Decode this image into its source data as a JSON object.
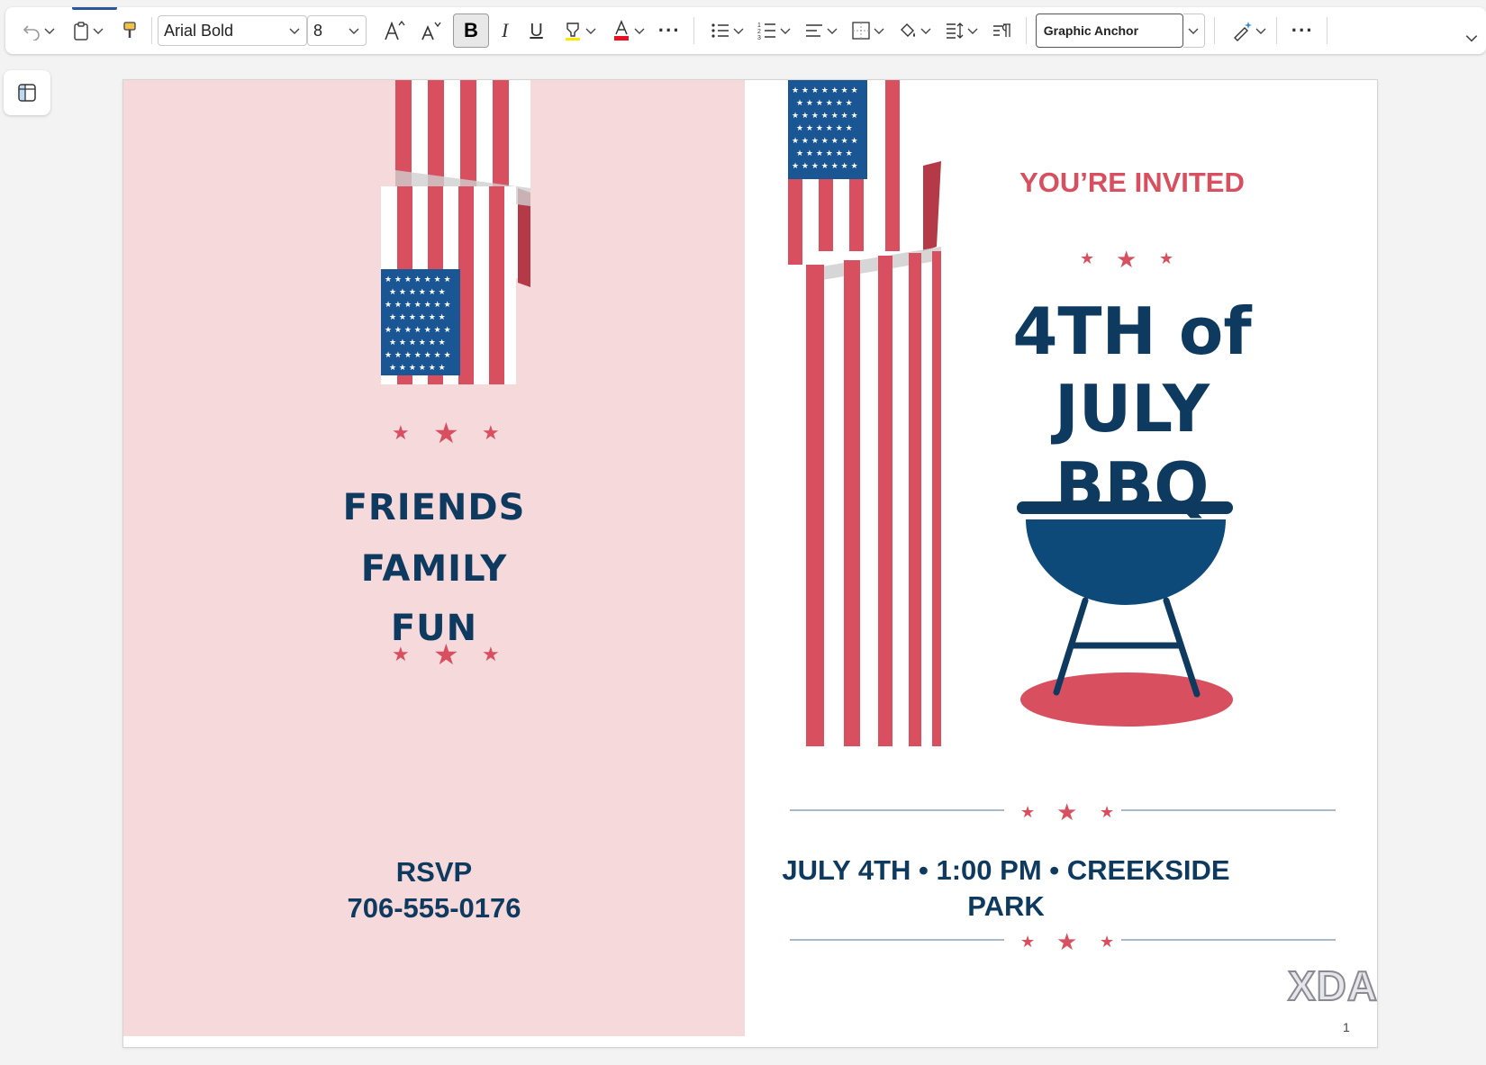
{
  "toolbar": {
    "font_name": "Arial Bold",
    "font_size": "8",
    "bold_label": "B",
    "italic_label": "I",
    "underline_label": "U",
    "style_name": "Graphic Anchor",
    "more_label": "···"
  },
  "colors": {
    "navy": "#0e3a5f",
    "red": "#d8505f",
    "pink_panel": "#f6d9db",
    "flag_blue": "#1a5694",
    "font_color_bar": "#e81123"
  },
  "document": {
    "left_panel": {
      "words": [
        "FRIENDS",
        "FAMILY",
        "FUN"
      ],
      "rsvp_label": "RSVP",
      "rsvp_phone": "706-555-0176"
    },
    "right_panel": {
      "invited": "YOU’RE INVITED",
      "headline_line1": "4TH of",
      "headline_line2": "JULY",
      "headline_line3": "BBQ",
      "details_line1": "JULY 4TH • 1:00 PM • CREEKSIDE",
      "details_line2": "PARK"
    },
    "page_number": "1"
  },
  "watermark": "XDA"
}
